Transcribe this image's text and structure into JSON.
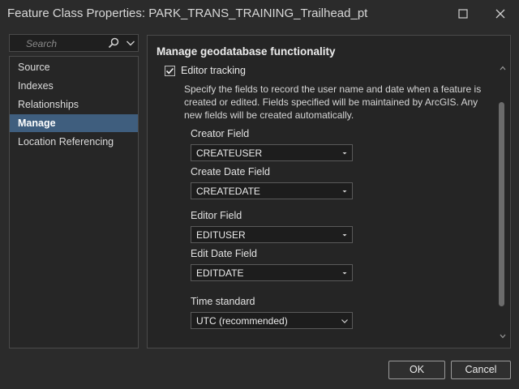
{
  "window": {
    "title": "Feature Class Properties: PARK_TRANS_TRAINING_Trailhead_pt",
    "minimize_icon": "maximize-square-icon",
    "close_icon": "close-icon"
  },
  "search": {
    "placeholder": "Search",
    "icon": "search-icon",
    "dropdown_icon": "chevron-down-icon"
  },
  "sidebar": {
    "items": [
      {
        "label": "Source",
        "selected": false
      },
      {
        "label": "Indexes",
        "selected": false
      },
      {
        "label": "Relationships",
        "selected": false
      },
      {
        "label": "Manage",
        "selected": true
      },
      {
        "label": "Location Referencing",
        "selected": false
      }
    ],
    "selected_color": "#3f5e7e"
  },
  "main": {
    "section_title": "Manage geodatabase functionality",
    "editor_tracking": {
      "label": "Editor tracking",
      "checked": true,
      "description": "Specify the fields to record the user name and date when a feature is created or edited. Fields specified will be maintained by ArcGIS. Any new fields will be created automatically."
    },
    "fields": [
      {
        "label": "Creator Field",
        "value": "CREATEUSER"
      },
      {
        "label": "Create Date Field",
        "value": "CREATEDATE"
      },
      {
        "label": "Editor Field",
        "value": "EDITUSER"
      },
      {
        "label": "Edit Date Field",
        "value": "EDITDATE"
      },
      {
        "label": "Time standard",
        "value": "UTC (recommended)"
      }
    ]
  },
  "buttons": {
    "ok": "OK",
    "cancel": "Cancel"
  }
}
